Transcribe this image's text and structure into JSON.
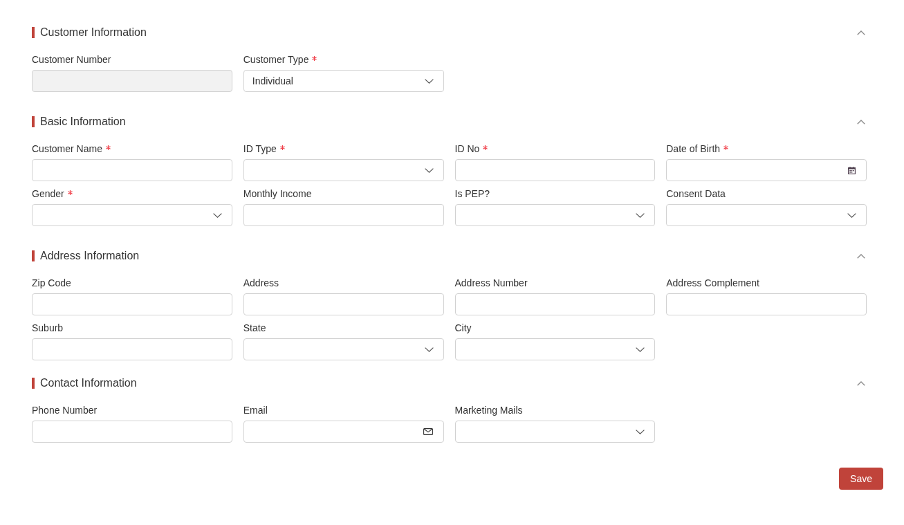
{
  "sections": [
    {
      "title": "Customer Information",
      "expanded": true,
      "fields": [
        {
          "label": "Customer Number",
          "required": false,
          "kind": "text",
          "disabled": true
        },
        {
          "label": "Customer Type",
          "required": true,
          "kind": "select",
          "disabled": false,
          "value": "Individual"
        }
      ]
    },
    {
      "title": "Basic Information",
      "expanded": true,
      "fields": [
        {
          "label": "Customer Name",
          "required": true,
          "kind": "text",
          "disabled": false
        },
        {
          "label": "ID Type",
          "required": true,
          "kind": "select",
          "disabled": false
        },
        {
          "label": "ID No",
          "required": true,
          "kind": "text",
          "disabled": false
        },
        {
          "label": "Date of Birth",
          "required": true,
          "kind": "date",
          "disabled": false
        },
        {
          "label": "Gender",
          "required": true,
          "kind": "select",
          "disabled": false
        },
        {
          "label": "Monthly Income",
          "required": false,
          "kind": "text",
          "disabled": false
        },
        {
          "label": "Is PEP?",
          "required": false,
          "kind": "select",
          "disabled": false
        },
        {
          "label": "Consent Data",
          "required": false,
          "kind": "select",
          "disabled": false
        }
      ]
    },
    {
      "title": "Address Information",
      "expanded": true,
      "fields": [
        {
          "label": "Zip Code",
          "required": false,
          "kind": "text",
          "disabled": false
        },
        {
          "label": "Address",
          "required": false,
          "kind": "text",
          "disabled": false
        },
        {
          "label": "Address Number",
          "required": false,
          "kind": "text",
          "disabled": false
        },
        {
          "label": "Address Complement",
          "required": false,
          "kind": "text",
          "disabled": false
        },
        {
          "label": "Suburb",
          "required": false,
          "kind": "text",
          "disabled": false
        },
        {
          "label": "State",
          "required": false,
          "kind": "select",
          "disabled": false
        },
        {
          "label": "City",
          "required": false,
          "kind": "select",
          "disabled": false
        }
      ]
    },
    {
      "title": "Contact Information",
      "expanded": true,
      "fields": [
        {
          "label": "Phone Number",
          "required": false,
          "kind": "text",
          "disabled": false
        },
        {
          "label": "Email",
          "required": false,
          "kind": "email",
          "disabled": false
        },
        {
          "label": "Marketing Mails",
          "required": false,
          "kind": "select",
          "disabled": false
        }
      ]
    }
  ],
  "buttons": [
    "Save"
  ]
}
